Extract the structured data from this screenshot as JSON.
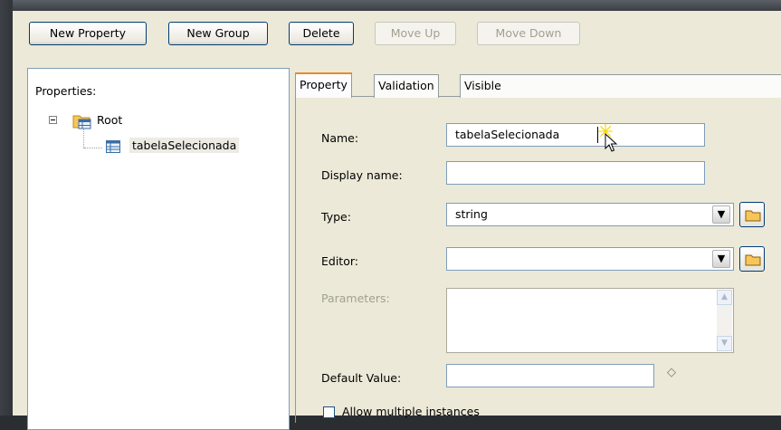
{
  "toolbar": {
    "new_property": "New Property",
    "new_group": "New Group",
    "delete": "Delete",
    "move_up": "Move Up",
    "move_down": "Move Down"
  },
  "tree": {
    "title": "Properties:",
    "root_label": "Root",
    "child_label": "tabelaSelecionada"
  },
  "tabs": [
    "Property",
    "Validation",
    "Visible"
  ],
  "form": {
    "name_label": "Name:",
    "name_value": "tabelaSelecionada",
    "display_name_label": "Display name:",
    "display_name_value": "",
    "type_label": "Type:",
    "type_value": "string",
    "editor_label": "Editor:",
    "editor_value": "",
    "parameters_label": "Parameters:",
    "default_value_label": "Default Value:",
    "default_value_value": "",
    "allow_multiple_label": "Allow multiple instances"
  },
  "icons": {
    "tree_expander": "minus-box-icon",
    "root": "folder-table-icon",
    "child": "table-icon",
    "browse": "folder-icon",
    "dropdown": "chevron-down-icon",
    "default_value_marker": "diamond-icon"
  },
  "colors": {
    "dialog_bg": "#ece9d8",
    "button_border": "#003c74",
    "active_tab_accent": "#e68b2c",
    "input_border": "#7f9db9",
    "desktop_bg": "#2b2e31"
  }
}
